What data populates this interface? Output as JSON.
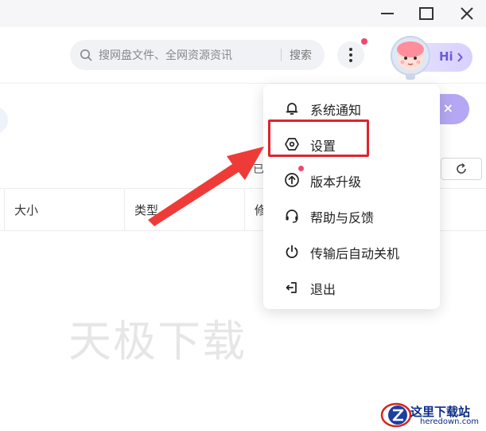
{
  "window_controls": {
    "minimize": "minimize-icon",
    "maximize": "maximize-icon",
    "close": "close-icon"
  },
  "header": {
    "search": {
      "placeholder": "搜网盘文件、全网资源资讯",
      "button_label": "搜索"
    },
    "more_menu_icon": "more-vertical-icon",
    "user": {
      "greeting": "Hi",
      "avatar": "astronaut-avatar"
    }
  },
  "background": {
    "partial_text": "已",
    "table_columns": [
      "大小",
      "类型",
      "修"
    ],
    "watermark": "天极下载"
  },
  "menu": {
    "items": [
      {
        "label": "系统通知",
        "icon": "bell-icon"
      },
      {
        "label": "设置",
        "icon": "settings-hexagon-icon"
      },
      {
        "label": "版本升级",
        "icon": "upgrade-arrow-icon"
      },
      {
        "label": "帮助与反馈",
        "icon": "headset-icon"
      },
      {
        "label": "传输后自动关机",
        "icon": "power-icon"
      },
      {
        "label": "退出",
        "icon": "exit-icon"
      }
    ]
  },
  "corner_logo": {
    "name": "这里下载站",
    "domain": "heredown.com"
  },
  "colors": {
    "highlight": "#e0242c",
    "arrow": "#ef3b37",
    "badge": "#f0476a",
    "accent_purple": "#6a5bd8"
  }
}
